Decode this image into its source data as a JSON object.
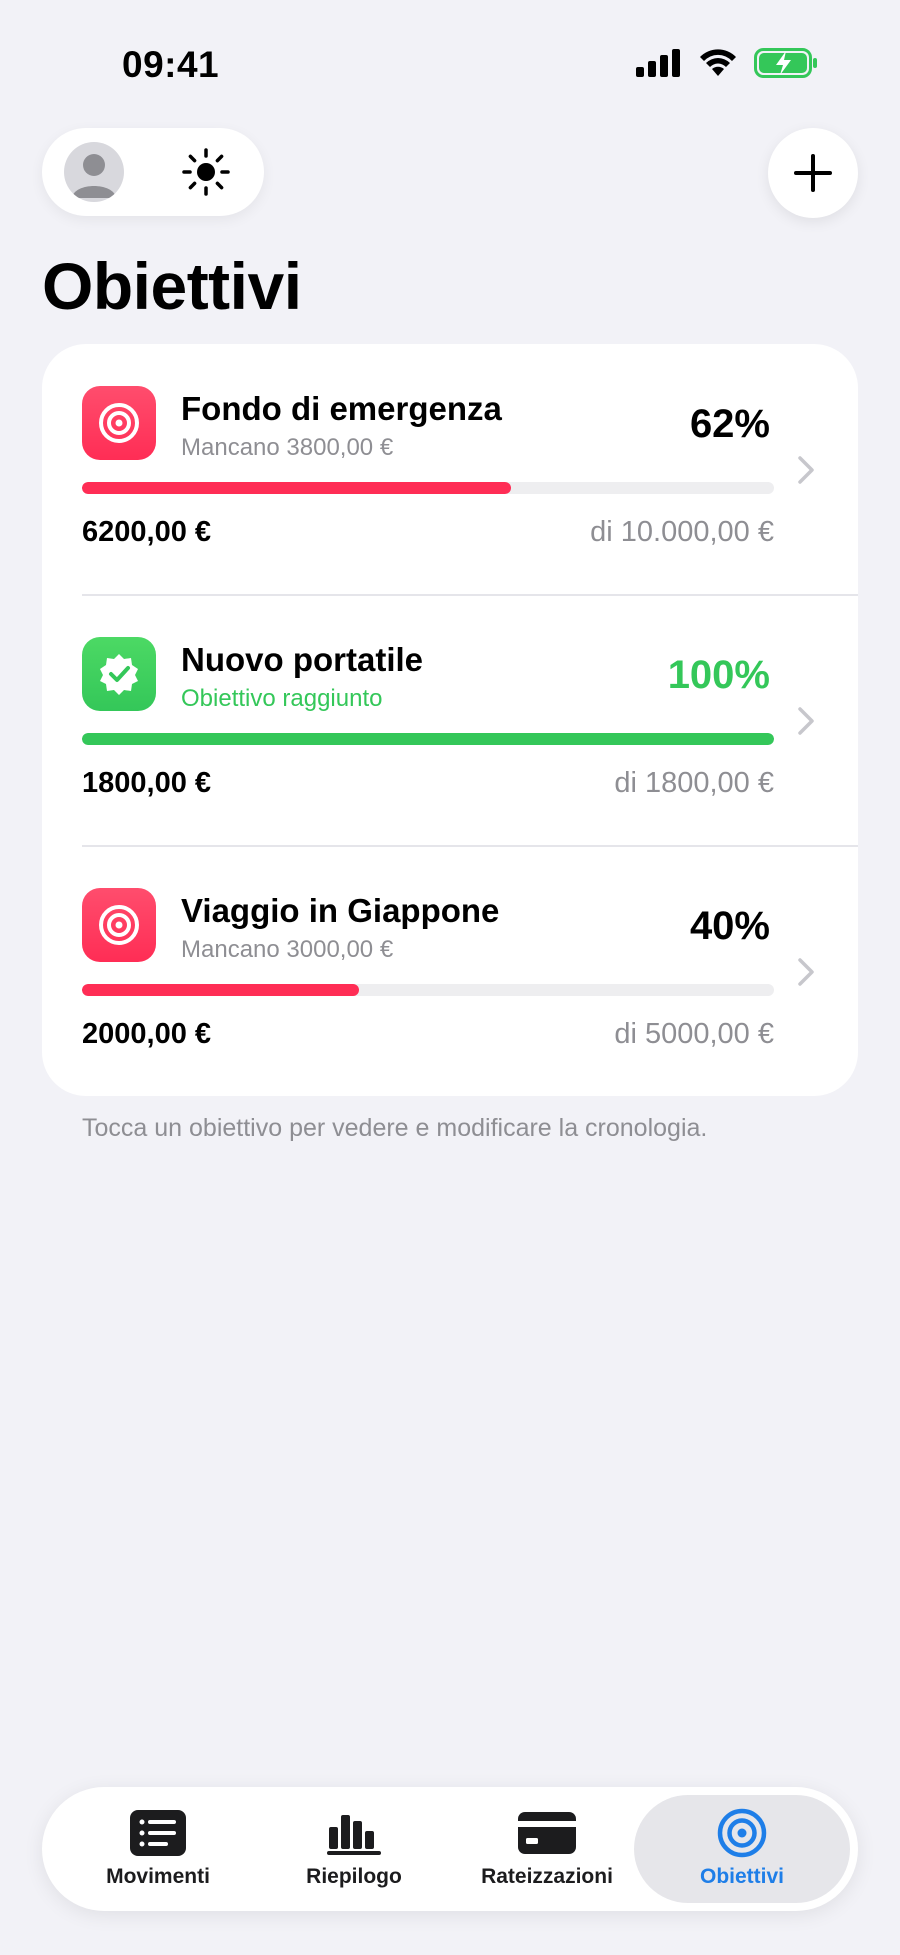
{
  "status_bar": {
    "time": "09:41"
  },
  "page": {
    "title": "Obiettivi"
  },
  "goals": [
    {
      "name": "Fondo di emergenza",
      "subtitle": "Mancano 3800,00 €",
      "percent_label": "62%",
      "progress": 0.62,
      "amount": "6200,00 €",
      "total": "di 10.000,00 €",
      "color": "#ff2d55",
      "status": "in-progress"
    },
    {
      "name": "Nuovo portatile",
      "subtitle": "Obiettivo raggiunto",
      "percent_label": "100%",
      "progress": 1.0,
      "amount": "1800,00 €",
      "total": "di 1800,00 €",
      "color": "#34c759",
      "status": "completed"
    },
    {
      "name": "Viaggio in Giappone",
      "subtitle": "Mancano 3000,00 €",
      "percent_label": "40%",
      "progress": 0.4,
      "amount": "2000,00 €",
      "total": "di 5000,00 €",
      "color": "#ff2d55",
      "status": "in-progress"
    }
  ],
  "hint": "Tocca un obiettivo per vedere e modificare la cronologia.",
  "tabbar": {
    "items": [
      {
        "label": "Movimenti",
        "icon": "list-icon"
      },
      {
        "label": "Riepilogo",
        "icon": "bar-chart-icon"
      },
      {
        "label": "Rateizzazioni",
        "icon": "credit-card-icon"
      },
      {
        "label": "Obiettivi",
        "icon": "target-icon",
        "active": true
      }
    ],
    "accent": "#1e7ee8"
  }
}
